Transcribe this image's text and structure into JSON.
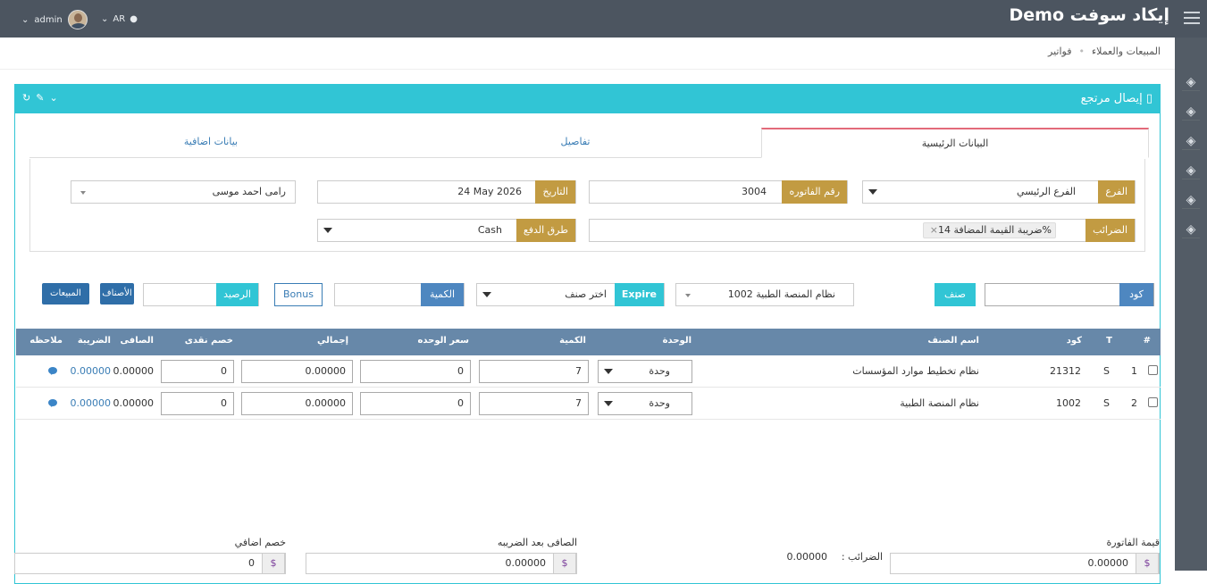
{
  "app": {
    "brand": "إيكاد سوفت Demo",
    "user": "admin",
    "lang": "AR"
  },
  "breadcrumb": [
    "المبيعات والعملاء",
    "فواتير"
  ],
  "panel": {
    "title": "إيصال مرتجع"
  },
  "tabs": [
    "البيانات الرئيسية",
    "تفاصيل",
    "بيانات اضافية"
  ],
  "header_form": {
    "branch_label": "الفرع",
    "branch_value": "الفرع الرئيسي",
    "invoice_label": "رقم الفاتوره",
    "invoice_value": "3004",
    "date_label": "التاريخ",
    "date_value": "24 May 2026",
    "customer_value": "رامى احمد موسى",
    "taxes_label": "الضرائب",
    "tax_chip": "ضريبة القيمة المضافة 14%",
    "payment_label": "طرق الدفع",
    "payment_value": "Cash"
  },
  "item_bar": {
    "code_label": "كود",
    "class_label": "صنف",
    "product_value": "نظام المنصة الطبية 1002",
    "expire_label": "Expire",
    "select_placeholder": "اختر صنف",
    "qty_label": "الكمية",
    "bonus_label": "Bonus",
    "balance_label": "الرصيد",
    "items_btn": "الأصناف",
    "sales_btn": "المبيعات"
  },
  "table": {
    "headers": {
      "num": "#",
      "t": "T",
      "code": "كود",
      "name": "اسم الصنف",
      "unit": "الوحدة",
      "qty": "الكمية",
      "price": "سعر الوحده",
      "total": "إجمالي",
      "cash_disc": "خصم نقدى",
      "net": "الصافى",
      "tax": "الضريبة",
      "note": "ملاحظه"
    },
    "rows": [
      {
        "num": "1",
        "t": "S",
        "code": "21312",
        "name": "نظام تخطيط موارد المؤسسات",
        "unit": "وحدة",
        "qty": "7",
        "price": "0",
        "total": "0.00000",
        "cash_disc": "0",
        "net": "0.00000",
        "tax": "0.00000"
      },
      {
        "num": "2",
        "t": "S",
        "code": "1002",
        "name": "نظام المنصة الطبية",
        "unit": "وحدة",
        "qty": "7",
        "price": "0",
        "total": "0.00000",
        "cash_disc": "0",
        "net": "0.00000",
        "tax": "0.00000"
      }
    ]
  },
  "totals": {
    "invoice_value_label": "قيمة الفاتورة",
    "invoice_value": "0.00000",
    "taxes_label": "الضرائب :",
    "taxes_value": "0.00000",
    "net_after_tax_label": "الصافى بعد الضريبه",
    "net_after_tax": "0.00000",
    "extra_disc_label": "خصم اضافي",
    "extra_disc": "0",
    "currency": "$"
  }
}
